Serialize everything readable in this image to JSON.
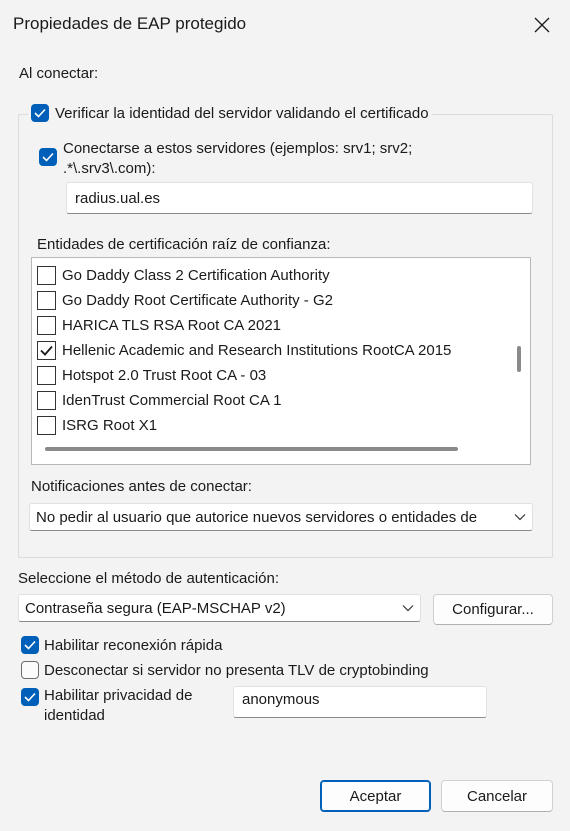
{
  "window": {
    "title": "Propiedades de EAP protegido"
  },
  "connect_label": "Al conectar:",
  "verify_server": {
    "label": "Verificar la identidad del servidor validando el certificado",
    "checked": true
  },
  "connect_servers": {
    "label_line1": "Conectarse a estos servidores (ejemplos: srv1; srv2;",
    "label_line2": ".*\\.srv3\\.com):",
    "checked": true,
    "value": "radius.ual.es"
  },
  "trusted_roots": {
    "label": "Entidades de certificación raíz de confianza:",
    "items": [
      {
        "label": "Go Daddy Class 2 Certification Authority",
        "checked": false
      },
      {
        "label": "Go Daddy Root Certificate Authority - G2",
        "checked": false
      },
      {
        "label": "HARICA TLS RSA Root CA 2021",
        "checked": false
      },
      {
        "label": "Hellenic Academic and Research Institutions RootCA 2015",
        "checked": true
      },
      {
        "label": "Hotspot 2.0 Trust Root CA - 03",
        "checked": false
      },
      {
        "label": "IdenTrust Commercial Root CA 1",
        "checked": false
      },
      {
        "label": "ISRG Root X1",
        "checked": false
      }
    ]
  },
  "notifications": {
    "label": "Notificaciones antes de conectar:",
    "selected": "No pedir al usuario que autorice nuevos servidores o entidades de"
  },
  "auth_method": {
    "label": "Seleccione el método de autenticación:",
    "selected": "Contraseña segura (EAP-MSCHAP v2)",
    "configure_label": "Configurar..."
  },
  "options": {
    "fast_reconnect": {
      "label": "Habilitar reconexión rápida",
      "checked": true
    },
    "disconnect_tlv": {
      "label": "Desconectar si servidor no presenta TLV de cryptobinding",
      "checked": false
    },
    "identity_privacy": {
      "label_line1": "Habilitar privacidad de",
      "label_line2": "identidad",
      "checked": true,
      "value": "anonymous"
    }
  },
  "buttons": {
    "ok_label": "Aceptar",
    "cancel_label": "Cancelar"
  },
  "colors": {
    "accent": "#005fb8",
    "background": "#f3f3f3"
  }
}
